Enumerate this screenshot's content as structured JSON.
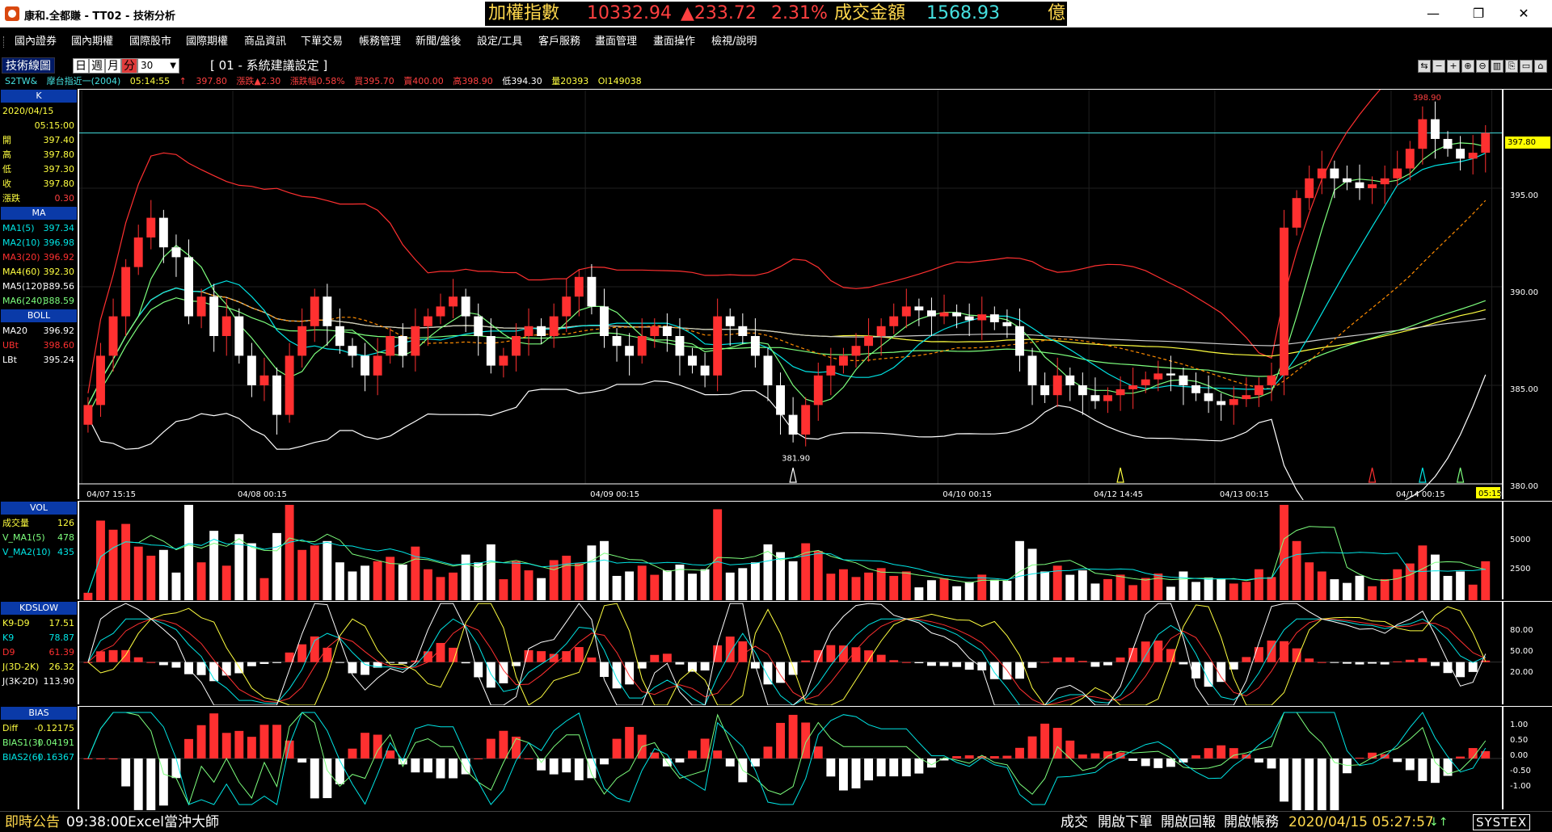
{
  "window": {
    "title": "康和.全都賺 - TT02 - 技術分析",
    "controls": {
      "minimize": "—",
      "maximize": "❐",
      "close": "✕"
    }
  },
  "ticker": {
    "label": "加權指數",
    "value": "10332.94",
    "change": "▲233.72",
    "change_pct": "2.31%",
    "volume_label": "成交金額",
    "volume_value": "1568.93",
    "unit": "億",
    "colors": {
      "label": "#ffd84d",
      "value": "#ff4040",
      "volume": "#45e0e0"
    }
  },
  "menu": [
    "國內證券",
    "國內期權",
    "國際股市",
    "國際期權",
    "商品資訊",
    "下單交易",
    "帳務管理",
    "新聞/盤後",
    "設定/工具",
    "客戶服務",
    "畫面管理",
    "畫面操作",
    "檢視/說明"
  ],
  "chart_header": {
    "tab": "技術線圖",
    "periods": [
      "日",
      "週",
      "月",
      "分"
    ],
    "active_period": "分",
    "interval": "30",
    "settings_label": "[ 01 - 系統建議設定 ]",
    "quote": {
      "symbol": "S2TW&",
      "name": "摩台指近一(2004)",
      "time": "05:14:55",
      "arrow": "↑",
      "price": "397.80",
      "chg_label": "漲跌▲2.30",
      "pct_label": "漲跌幅0.58%",
      "bid": "買395.70",
      "ask": "賣400.00",
      "high": "高398.90",
      "low": "低394.30",
      "vol": "量20393",
      "oi": "OI149038"
    },
    "tools": [
      "⇆",
      "−",
      "+",
      "⊕",
      "⊖",
      "▥",
      "⎘",
      "▭",
      "⌂"
    ]
  },
  "k_panel": {
    "title": "K",
    "date": "2020/04/15",
    "time": "05:15:00",
    "rows": [
      {
        "label": "開",
        "value": "397.40"
      },
      {
        "label": "高",
        "value": "397.80"
      },
      {
        "label": "低",
        "value": "397.30"
      },
      {
        "label": "收",
        "value": "397.80"
      },
      {
        "label": "漲跌",
        "value": "0.30"
      }
    ]
  },
  "ma_panel": {
    "title": "MA",
    "rows": [
      {
        "label": "MA1(5)",
        "value": "397.34",
        "color": "#00e5e5"
      },
      {
        "label": "MA2(10)",
        "value": "396.98",
        "color": "#00e5e5"
      },
      {
        "label": "MA3(20)",
        "value": "396.92",
        "color": "#ff3030"
      },
      {
        "label": "MA4(60)",
        "value": "392.30",
        "color": "#ffff40"
      },
      {
        "label": "MA5(120)",
        "value": "389.56",
        "color": "#ffffff"
      },
      {
        "label": "MA6(240)",
        "value": "388.59",
        "color": "#7dff7d"
      }
    ]
  },
  "boll_panel": {
    "title": "BOLL",
    "rows": [
      {
        "label": "MA20",
        "value": "396.92",
        "color": "#ffffff"
      },
      {
        "label": "UBt",
        "value": "398.60",
        "color": "#ff3030"
      },
      {
        "label": "LBt",
        "value": "395.24",
        "color": "#ffffff"
      }
    ]
  },
  "vol_panel": {
    "title": "VOL",
    "rows": [
      {
        "label": "成交量",
        "value": "126",
        "color": "#ffff40"
      },
      {
        "label": "V_MA1(5)",
        "value": "478",
        "color": "#7dff7d"
      },
      {
        "label": "V_MA2(10)",
        "value": "435",
        "color": "#00e5e5"
      }
    ]
  },
  "kd_panel": {
    "title": "KDSLOW",
    "rows": [
      {
        "label": "K9-D9",
        "value": "17.51",
        "color": "#ffff40"
      },
      {
        "label": "K9",
        "value": "78.87",
        "color": "#00e5e5"
      },
      {
        "label": "D9",
        "value": "61.39",
        "color": "#ff3030"
      },
      {
        "label": "J(3D-2K)",
        "value": "26.32",
        "color": "#ffff40"
      },
      {
        "label": "J(3K-2D)",
        "value": "113.90",
        "color": "#ffffff"
      }
    ]
  },
  "bias_panel": {
    "title": "BIAS",
    "rows": [
      {
        "label": "Diff",
        "value": "-0.12175",
        "color": "#ffff40"
      },
      {
        "label": "BIAS1(3)",
        "value": "0.04191",
        "color": "#7dff7d"
      },
      {
        "label": "BIAS2(6)",
        "value": "0.16367",
        "color": "#00e5e5"
      }
    ]
  },
  "axes": {
    "price_ticks": [
      "395.00",
      "390.00",
      "385.00",
      "380.00"
    ],
    "current_price": "397.80",
    "vol_ticks": [
      "5000",
      "2500"
    ],
    "kd_ticks": [
      "80.00",
      "50.00",
      "20.00"
    ],
    "bias_ticks": [
      "1.00",
      "0.50",
      "0.00",
      "-0.50",
      "-1.00"
    ],
    "time_end": "05:15",
    "date_labels": [
      "04/07 15:15",
      "04/08 00:15",
      "04/09 00:15",
      "04/10 00:15",
      "04/12 14:45",
      "04/13 00:15",
      "04/14 00:15",
      "04/15 00:15"
    ],
    "high_annotation": "398.90",
    "low_annotation": "381.90"
  },
  "statusbar": {
    "notice": "即時公告",
    "time": "09:38:00",
    "message": "Excel當沖大師",
    "buttons": [
      "成交",
      "開啟下單",
      "開啟回報",
      "開啟帳務"
    ],
    "clock": "2020/04/15 05:27:57",
    "brand": "SYSTEX"
  },
  "chart_data": {
    "type": "candlestick",
    "title": "",
    "instrument": "摩台指近一(2004)",
    "interval_minutes": 30,
    "ylim": [
      380,
      400
    ],
    "up_color": "#ff3030",
    "down_color": "#ffffff",
    "sessions": [
      "04/07 15:15",
      "04/08 00:15",
      "04/09 00:15",
      "04/10 00:15",
      "04/12 14:45",
      "04/13 00:15",
      "04/14 00:15",
      "04/15 00:15"
    ],
    "close": [
      384.0,
      386.5,
      388.5,
      391.0,
      392.5,
      393.5,
      392.0,
      391.5,
      388.5,
      389.5,
      387.5,
      388.5,
      386.5,
      385.0,
      385.5,
      383.5,
      386.5,
      388.0,
      389.5,
      388.0,
      387.0,
      386.5,
      385.5,
      386.5,
      387.5,
      386.5,
      388.0,
      388.5,
      389.0,
      389.5,
      388.5,
      387.5,
      386.0,
      386.5,
      387.5,
      388.0,
      387.5,
      388.5,
      389.5,
      390.5,
      389.0,
      387.5,
      387.0,
      386.5,
      387.5,
      388.0,
      387.5,
      386.5,
      386.0,
      385.5,
      388.5,
      388.0,
      387.5,
      386.5,
      385.0,
      383.5,
      382.5,
      384.0,
      385.5,
      386.0,
      386.5,
      387.0,
      387.5,
      388.0,
      388.5,
      389.0,
      388.8,
      388.5,
      388.7,
      388.5,
      388.3,
      388.6,
      388.2,
      388.0,
      386.5,
      385.0,
      384.5,
      385.5,
      385.0,
      384.5,
      384.2,
      384.5,
      384.8,
      385.0,
      385.3,
      385.6,
      385.5,
      385.0,
      384.6,
      384.2,
      384.0,
      384.3,
      384.5,
      385.0,
      385.5,
      393.0,
      394.5,
      395.5,
      396.0,
      395.5,
      395.3,
      395.0,
      395.2,
      395.5,
      396.0,
      397.0,
      398.5,
      397.5,
      397.0,
      396.5,
      396.8,
      397.8
    ],
    "series": [
      {
        "name": "MA1(5)",
        "last": 397.34
      },
      {
        "name": "MA2(10)",
        "last": 396.98
      },
      {
        "name": "MA3(20)",
        "last": 396.92
      },
      {
        "name": "MA4(60)",
        "last": 392.3
      },
      {
        "name": "MA5(120)",
        "last": 389.56
      },
      {
        "name": "MA6(240)",
        "last": 388.59
      }
    ],
    "high": 398.9,
    "low": 381.9,
    "last": 397.8
  }
}
